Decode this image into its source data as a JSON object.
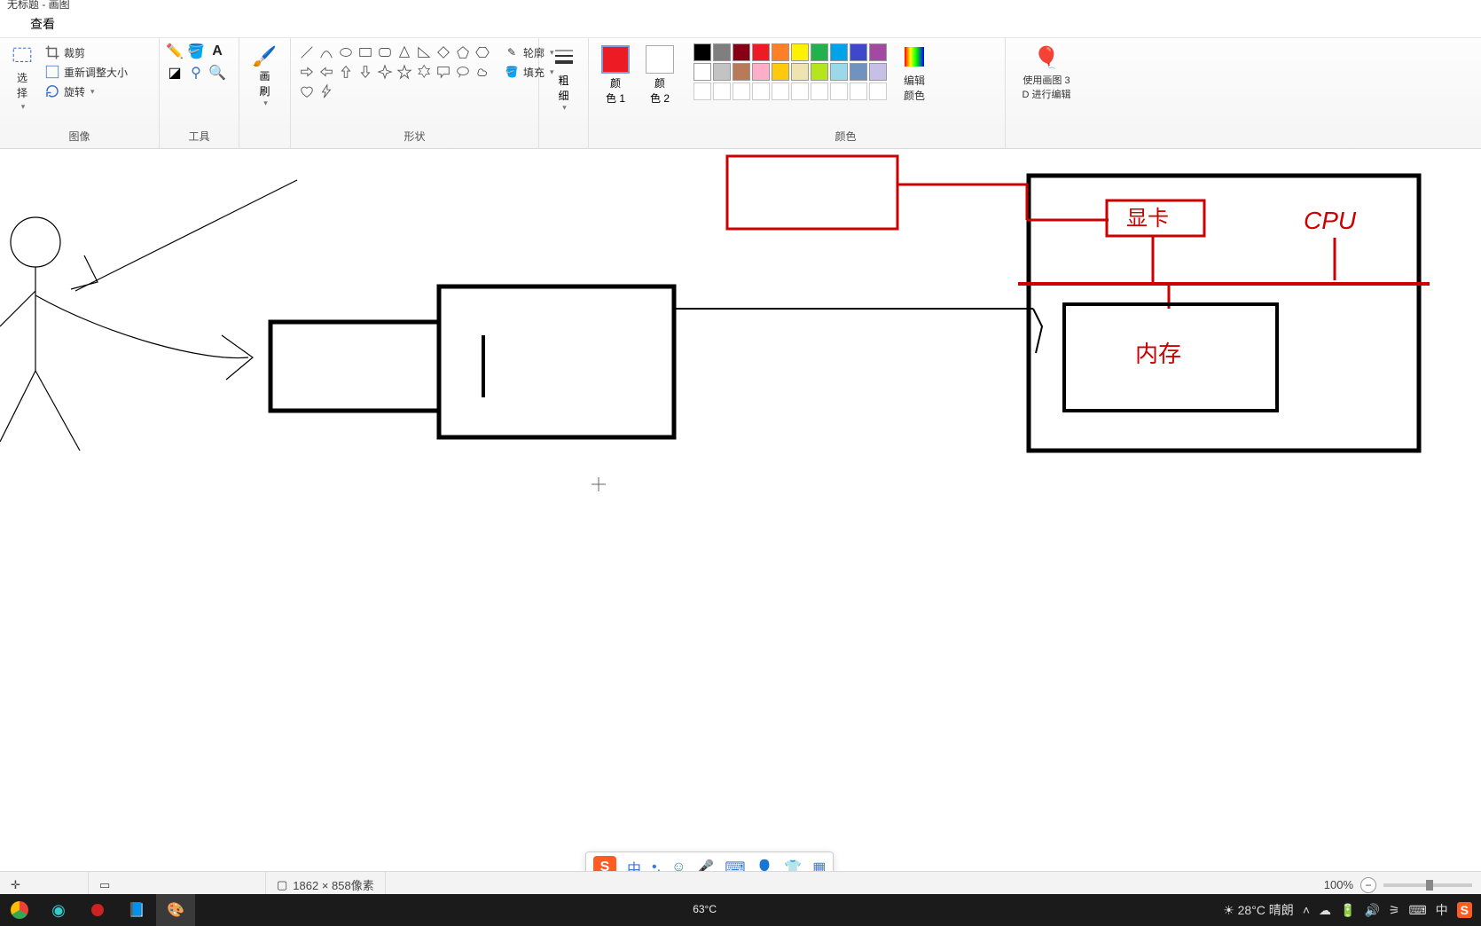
{
  "title_fragment": "无标题 - 画图",
  "tabs": {
    "view": "查看"
  },
  "ribbon": {
    "image_group": {
      "label": "图像",
      "select": "选\n择",
      "crop": "裁剪",
      "resize": "重新调整大小",
      "rotate": "旋转"
    },
    "tools_group": {
      "label": "工具"
    },
    "brush": {
      "label": "画\n刷"
    },
    "shapes_group": {
      "label": "形状",
      "outline": "轮廓",
      "fill": "填充"
    },
    "thickness": {
      "label": "粗\n细"
    },
    "color1": {
      "label": "颜\n色 1"
    },
    "color2": {
      "label": "颜\n色 2"
    },
    "colors_group": {
      "label": "颜色"
    },
    "edit_colors": {
      "label": "编辑\n颜色"
    },
    "paint3d": {
      "label": "使用画图 3\nD 进行编辑"
    },
    "palette_colors": {
      "row1": [
        "#000000",
        "#7f7f7f",
        "#880015",
        "#ed1c24",
        "#ff7f27",
        "#fff200",
        "#22b14c",
        "#00a2e8",
        "#3f48cc",
        "#a349a4"
      ],
      "row2": [
        "#ffffff",
        "#c3c3c3",
        "#b97a57",
        "#ffaec9",
        "#ffc90e",
        "#efe4b0",
        "#b5e61d",
        "#99d9ea",
        "#7092be",
        "#c8bfe7"
      ],
      "row3": [
        "",
        "",
        "",
        "",
        "",
        "",
        "",
        "",
        "",
        ""
      ]
    },
    "current_color1": "#ed1c24",
    "current_color2": "#ffffff"
  },
  "canvas_labels": {
    "gpu": "显卡",
    "cpu": "CPU",
    "memory": "内存"
  },
  "statusbar": {
    "dimensions": "1862 × 858像素",
    "zoom": "100%"
  },
  "ime": {
    "lang": "中"
  },
  "taskbar": {
    "temp_center": "63°C",
    "weather_right": "28°C 晴朗",
    "tray_lang": "中"
  }
}
